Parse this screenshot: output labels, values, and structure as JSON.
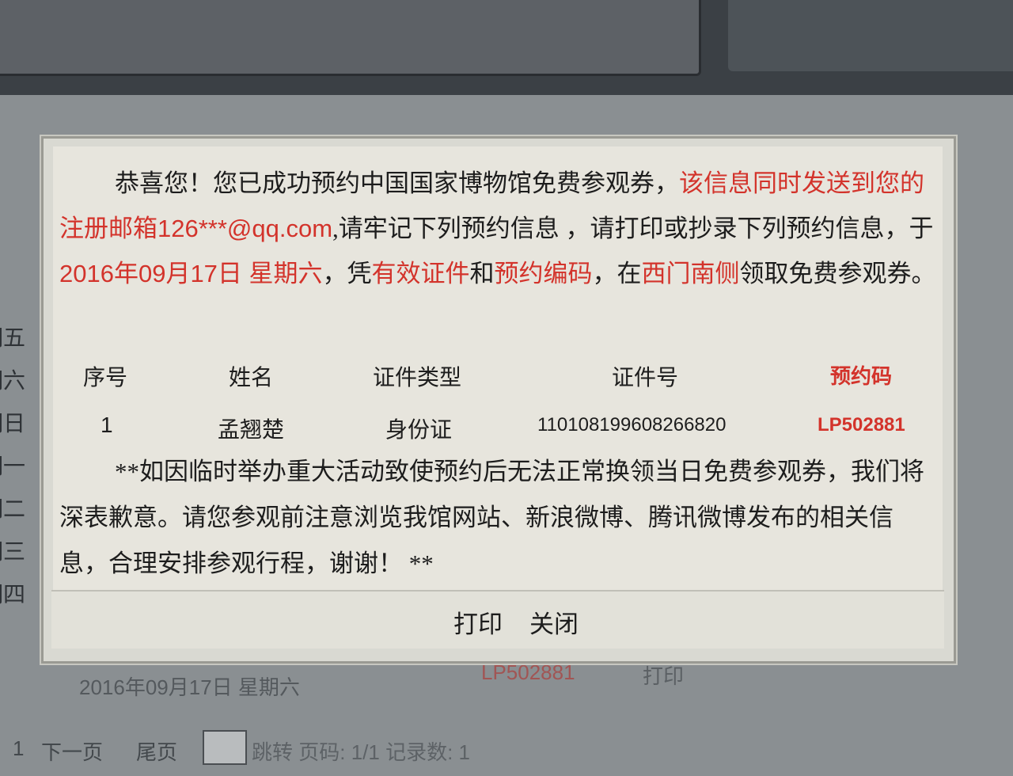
{
  "background": {
    "weekdays": [
      "期五",
      "期六",
      "期日",
      "期一",
      "期二",
      "期三",
      "期四"
    ],
    "row": {
      "date": "2016年09月17日 星期六",
      "code": "LP502881",
      "print": "打印"
    },
    "pager": {
      "page_num": "1",
      "next": "下一页",
      "last": "尾页",
      "goto": "跳转",
      "info": "页码: 1/1 记录数: 1"
    }
  },
  "dialog": {
    "message": {
      "greeting": "恭喜您！您已成功预约中国国家博物馆免费参观券，",
      "sent_notice": "该信息同时发送到您的注册邮箱126***@qq.com",
      "remember": ",请牢记下列预约信息 ，请打印或抄录下列预约信息，于",
      "date": "2016年09月17日 星期六",
      "with": "，凭",
      "valid_id": "有效证件",
      "and": "和",
      "booking_code": "预约编码",
      "at": "，在",
      "location": "西门南侧",
      "collect": "领取免费参观券。"
    },
    "table": {
      "headers": [
        "序号",
        "姓名",
        "证件类型",
        "证件号",
        "预约码"
      ],
      "rows": [
        [
          "1",
          "孟翘楚",
          "身份证",
          "110108199608266820",
          "LP502881"
        ]
      ]
    },
    "notice": "**如因临时举办重大活动致使预约后无法正常换领当日免费参观券，我们将深表歉意。请您参观前注意浏览我馆网站、新浪微博、腾讯微博发布的相关信息，合理安排参观行程，谢谢！ **",
    "buttons": {
      "print": "打印",
      "close": "关闭"
    }
  },
  "colors": {
    "accent_red": "#d3332b",
    "dialog_bg": "#e7e5dd",
    "text": "#1d1d1d"
  }
}
